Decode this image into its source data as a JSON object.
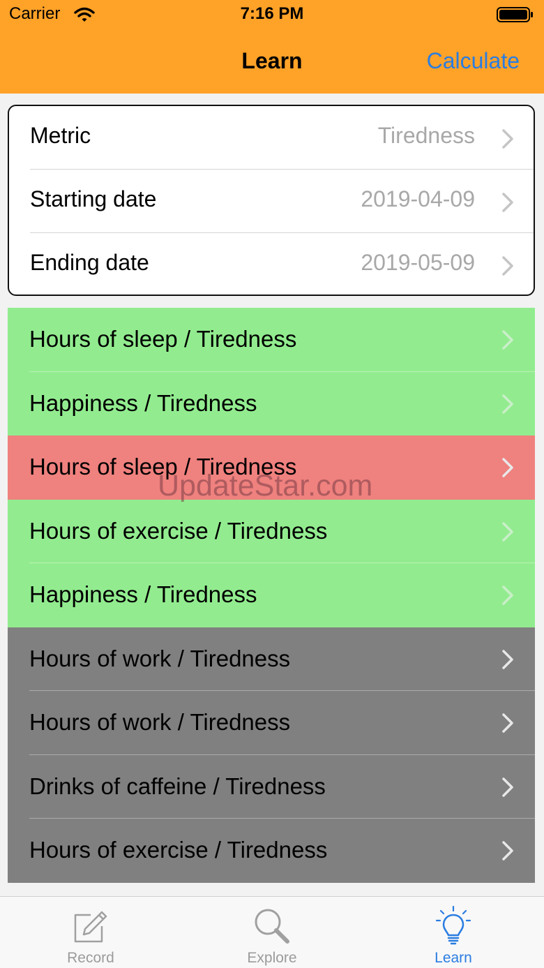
{
  "status_bar": {
    "carrier": "Carrier",
    "time": "7:16 PM"
  },
  "nav": {
    "title": "Learn",
    "action": "Calculate"
  },
  "settings": [
    {
      "label": "Metric",
      "value": "Tiredness"
    },
    {
      "label": "Starting date",
      "value": "2019-04-09"
    },
    {
      "label": "Ending date",
      "value": "2019-05-09"
    }
  ],
  "results": [
    {
      "label": "Hours of sleep / Tiredness",
      "status": "positive"
    },
    {
      "label": "Happiness / Tiredness",
      "status": "positive"
    },
    {
      "label": "Hours of sleep / Tiredness",
      "status": "negative"
    },
    {
      "label": "Hours of exercise / Tiredness",
      "status": "positive"
    },
    {
      "label": "Happiness / Tiredness",
      "status": "positive"
    },
    {
      "label": "Hours of work / Tiredness",
      "status": "neutral"
    },
    {
      "label": "Hours of work / Tiredness",
      "status": "neutral"
    },
    {
      "label": "Drinks of caffeine / Tiredness",
      "status": "neutral"
    },
    {
      "label": "Hours of exercise / Tiredness",
      "status": "neutral"
    }
  ],
  "status_colors": {
    "positive": "#92ec8f",
    "negative": "#ef817e",
    "neutral": "#808080"
  },
  "colors": {
    "header": "#fea228",
    "accent": "#2a7de1"
  },
  "watermark": "UpdateStar.com",
  "tabs": [
    {
      "label": "Record",
      "icon": "pencil-square-icon",
      "active": false
    },
    {
      "label": "Explore",
      "icon": "magnifier-icon",
      "active": false
    },
    {
      "label": "Learn",
      "icon": "lightbulb-icon",
      "active": true
    }
  ]
}
